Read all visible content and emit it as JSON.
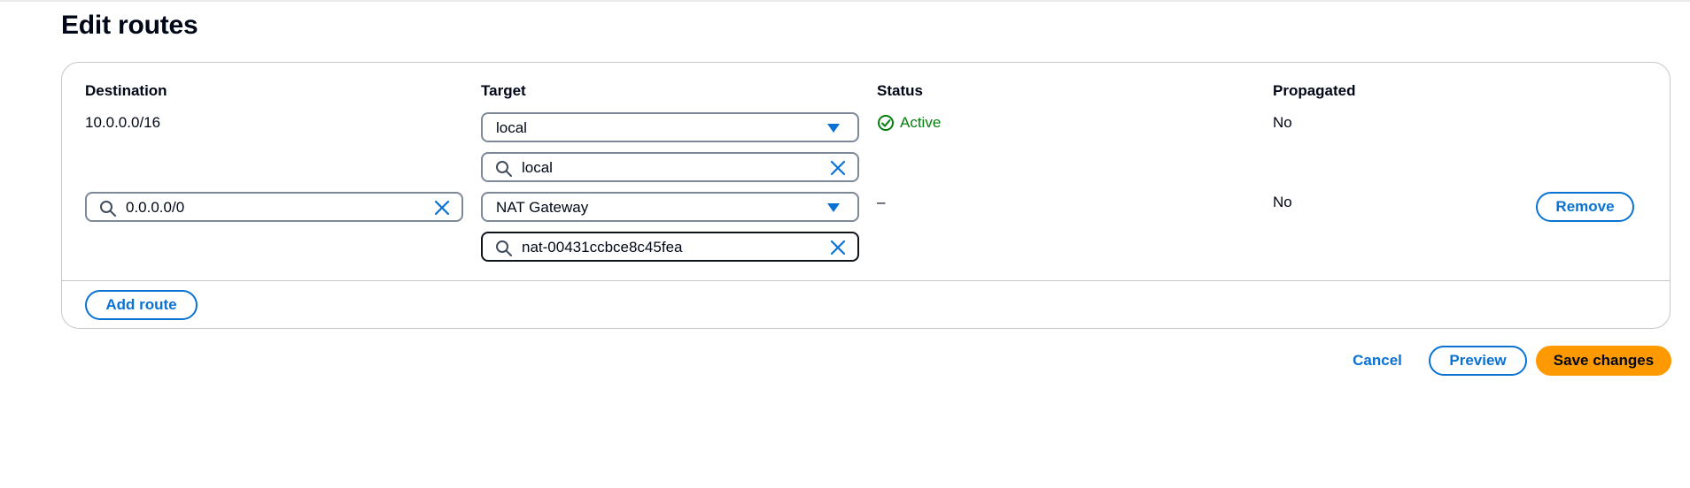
{
  "page": {
    "title": "Edit routes"
  },
  "columns": {
    "destination": "Destination",
    "target": "Target",
    "status": "Status",
    "propagated": "Propagated"
  },
  "routes": [
    {
      "destination": "10.0.0.0/16",
      "target_select": "local",
      "target_search": "local",
      "status": "Active",
      "propagated": "No"
    },
    {
      "destination_input": "0.0.0.0/0",
      "target_select": "NAT Gateway",
      "target_search": "nat-00431ccbce8c45fea",
      "status": "–",
      "propagated": "No",
      "remove_label": "Remove"
    }
  ],
  "actions": {
    "add_route": "Add route",
    "cancel": "Cancel",
    "preview": "Preview",
    "save": "Save changes"
  },
  "colors": {
    "accent": "#0972d3",
    "primary": "#ff9900",
    "success": "#037f0c",
    "border": "#7d8998"
  },
  "icons": [
    "search-icon",
    "clear-icon",
    "caret-down-icon",
    "status-check-icon"
  ]
}
